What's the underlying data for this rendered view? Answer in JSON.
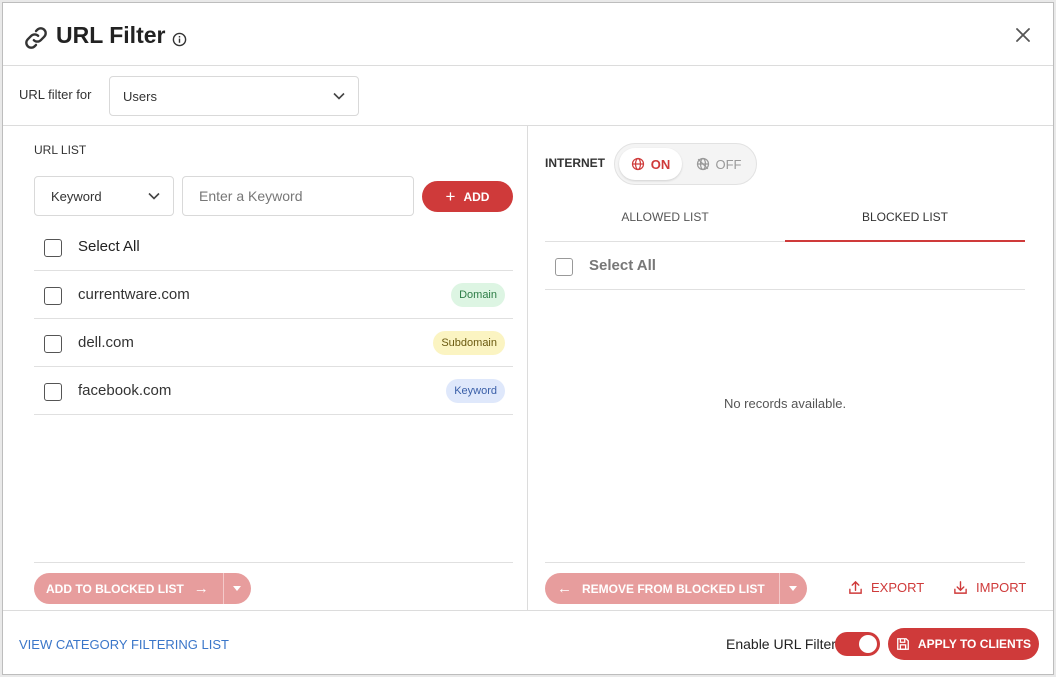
{
  "header": {
    "title": "URL Filter"
  },
  "filter_for": {
    "label": "URL filter for",
    "selected": "Users"
  },
  "url_list": {
    "label": "URL LIST",
    "type_select": "Keyword",
    "input_placeholder": "Enter a Keyword",
    "add_label": "ADD",
    "select_all": "Select All",
    "items": [
      {
        "url": "currentware.com",
        "type": "Domain"
      },
      {
        "url": "dell.com",
        "type": "Subdomain"
      },
      {
        "url": "facebook.com",
        "type": "Keyword"
      }
    ],
    "add_to_blocked": "ADD TO BLOCKED LIST"
  },
  "internet": {
    "label": "INTERNET",
    "on": "ON",
    "off": "OFF"
  },
  "tabs": {
    "allowed": "ALLOWED LIST",
    "blocked": "BLOCKED LIST"
  },
  "blocked_list": {
    "select_all": "Select All",
    "empty": "No records available.",
    "remove_label": "REMOVE FROM BLOCKED LIST",
    "export": "EXPORT",
    "import": "IMPORT"
  },
  "footer": {
    "category_link": "VIEW CATEGORY FILTERING LIST",
    "enable_label": "Enable URL Filter",
    "apply_label": "APPLY TO CLIENTS"
  },
  "colors": {
    "accent": "#cf3a3a",
    "link": "#3a76c9",
    "disabled_accent": "#e79d9d"
  }
}
